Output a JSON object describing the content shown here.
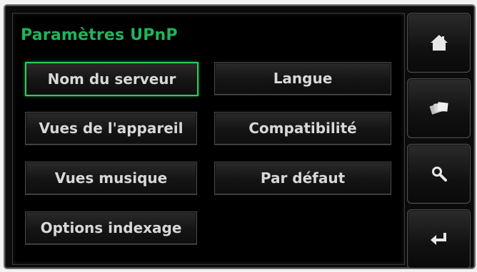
{
  "screen": {
    "title": "Paramètres UPnP"
  },
  "buttons": {
    "nom_du_serveur": "Nom du serveur",
    "langue": "Langue",
    "vues_appareil": "Vues de l'appareil",
    "compatibilite": "Compatibilité",
    "vues_musique": "Vues musique",
    "par_defaut": "Par défaut",
    "options_indexage": "Options indexage"
  },
  "sidebar": {
    "icons": [
      "home-icon",
      "cards-icon",
      "search-icon",
      "return-icon"
    ]
  },
  "colors": {
    "accent": "#2ecb5e",
    "title": "#22b35a",
    "text": "#d8d8d8",
    "background": "#000000"
  }
}
